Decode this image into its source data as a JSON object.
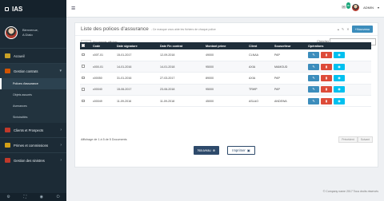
{
  "app": {
    "name": "IAS"
  },
  "user": {
    "welcome": "Bienvenue,",
    "name": "A Dialo"
  },
  "sidebar": {
    "items": [
      {
        "label": "Accueil",
        "color": "#c9a227"
      },
      {
        "label": "Gestion contrats",
        "color": "#d35400"
      }
    ],
    "submenu": [
      {
        "label": "Polices d'assurance"
      },
      {
        "label": "Objets assurés"
      },
      {
        "label": "Avenances"
      },
      {
        "label": "Sinistralités"
      }
    ],
    "items2": [
      {
        "label": "Clients et Prospects",
        "color": "#c0392b"
      },
      {
        "label": "Primes et commissions",
        "color": "#d4a017"
      },
      {
        "label": "Gestion des sinistres",
        "color": "#c0392b"
      }
    ]
  },
  "topbar": {
    "badge": "39",
    "user": "ADMIN"
  },
  "panel": {
    "title": "Liste des polices d'assurance",
    "subtitle": "- Ce masque vous aide les fichiers de chaque police",
    "new_label": "Nouveau",
    "length_value": "10",
    "length_label": "documents affichés",
    "search_label": "Chercher",
    "columns": [
      "Code",
      "Date signature",
      "Date Fin contrat",
      "Montant prime",
      "Client",
      "Souscriteur",
      "Opérations"
    ],
    "rows": [
      [
        "c00T-01",
        "15-01-2017",
        "12-09-2018",
        "49000",
        "CLNAA",
        "PAP"
      ],
      [
        "c000-01",
        "14-01-2016",
        "14-01-2018",
        "95000",
        "AXIA",
        "MAMOUD"
      ],
      [
        "c00050",
        "31-01-2016",
        "27-03-2017",
        "89000",
        "AXIA",
        "PAP"
      ],
      [
        "c00040",
        "15-06-2017",
        "23-06-2018",
        "95000",
        "TRWP",
        "PAP"
      ],
      [
        "c00049",
        "11-09-2016",
        "11-09-2018",
        "45000",
        "ASLAO",
        "ANDEWA"
      ]
    ],
    "info": "Affichage de 1 à 5 de 5 Documents",
    "prev": "Précédent",
    "next": "Suivant",
    "btn_new": "Nouveau",
    "btn_print": "Imprimer"
  },
  "footer": {
    "text": "© Company name 2017 Tous droits réservés"
  }
}
